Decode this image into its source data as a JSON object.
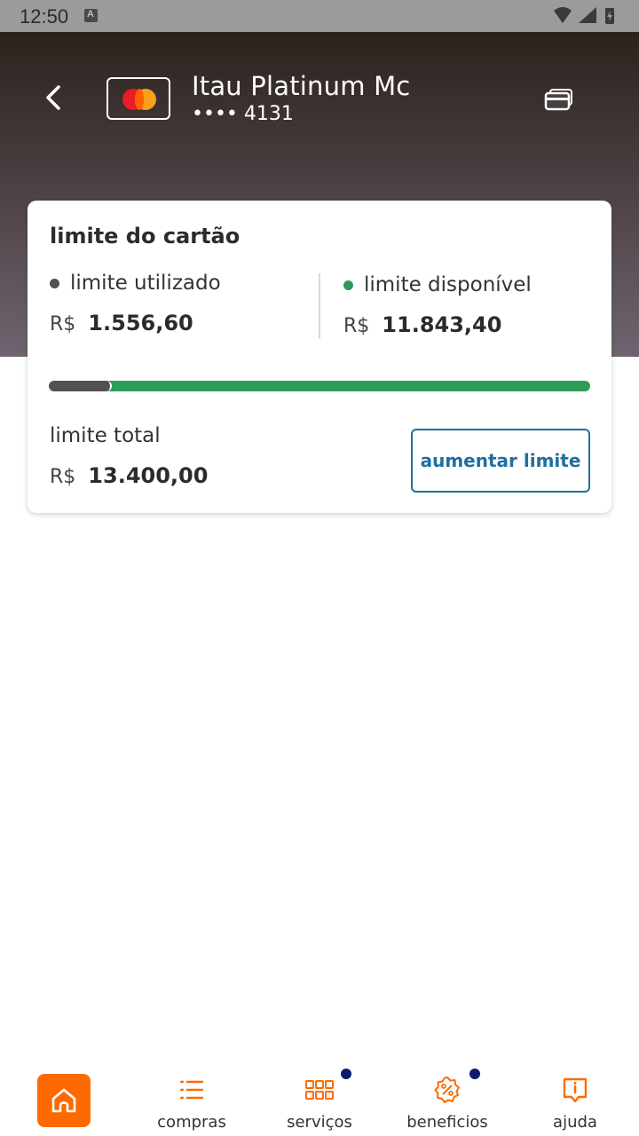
{
  "status_bar": {
    "time": "12:50"
  },
  "header": {
    "card_name": "Itau Platinum Mc",
    "card_digits": "•••• 4131",
    "back_icon": "chevron-left-icon",
    "cards_icon": "cards-icon",
    "brand_icon": "mastercard-logo"
  },
  "limit": {
    "title": "limite do cartão",
    "used_label": "limite utilizado",
    "used_currency": "R$",
    "used_amount": "1.556,60",
    "available_label": "limite disponível",
    "available_currency": "R$",
    "available_amount": "11.843,40",
    "used_fraction": 0.116,
    "total_label": "limite total",
    "total_currency": "R$",
    "total_amount": "13.400,00",
    "raise_button": "aumentar limite",
    "colors": {
      "used": "#555050",
      "available": "#2a9d57"
    }
  },
  "nav": {
    "home_icon": "home-icon",
    "items": [
      {
        "label": "compras",
        "icon": "list-icon"
      },
      {
        "label": "serviços",
        "icon": "grid-icon"
      },
      {
        "label": "beneficios",
        "icon": "discount-badge-icon"
      },
      {
        "label": "ajuda",
        "icon": "info-chat-icon"
      }
    ],
    "accent": "#ff6a00"
  }
}
